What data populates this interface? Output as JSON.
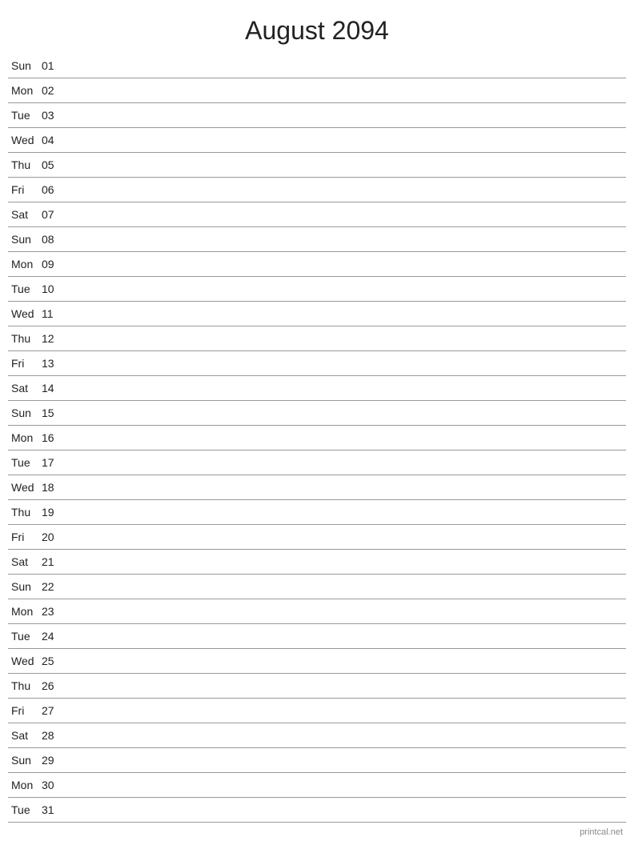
{
  "title": "August 2094",
  "footer": "printcal.net",
  "days": [
    {
      "name": "Sun",
      "num": "01"
    },
    {
      "name": "Mon",
      "num": "02"
    },
    {
      "name": "Tue",
      "num": "03"
    },
    {
      "name": "Wed",
      "num": "04"
    },
    {
      "name": "Thu",
      "num": "05"
    },
    {
      "name": "Fri",
      "num": "06"
    },
    {
      "name": "Sat",
      "num": "07"
    },
    {
      "name": "Sun",
      "num": "08"
    },
    {
      "name": "Mon",
      "num": "09"
    },
    {
      "name": "Tue",
      "num": "10"
    },
    {
      "name": "Wed",
      "num": "11"
    },
    {
      "name": "Thu",
      "num": "12"
    },
    {
      "name": "Fri",
      "num": "13"
    },
    {
      "name": "Sat",
      "num": "14"
    },
    {
      "name": "Sun",
      "num": "15"
    },
    {
      "name": "Mon",
      "num": "16"
    },
    {
      "name": "Tue",
      "num": "17"
    },
    {
      "name": "Wed",
      "num": "18"
    },
    {
      "name": "Thu",
      "num": "19"
    },
    {
      "name": "Fri",
      "num": "20"
    },
    {
      "name": "Sat",
      "num": "21"
    },
    {
      "name": "Sun",
      "num": "22"
    },
    {
      "name": "Mon",
      "num": "23"
    },
    {
      "name": "Tue",
      "num": "24"
    },
    {
      "name": "Wed",
      "num": "25"
    },
    {
      "name": "Thu",
      "num": "26"
    },
    {
      "name": "Fri",
      "num": "27"
    },
    {
      "name": "Sat",
      "num": "28"
    },
    {
      "name": "Sun",
      "num": "29"
    },
    {
      "name": "Mon",
      "num": "30"
    },
    {
      "name": "Tue",
      "num": "31"
    }
  ]
}
